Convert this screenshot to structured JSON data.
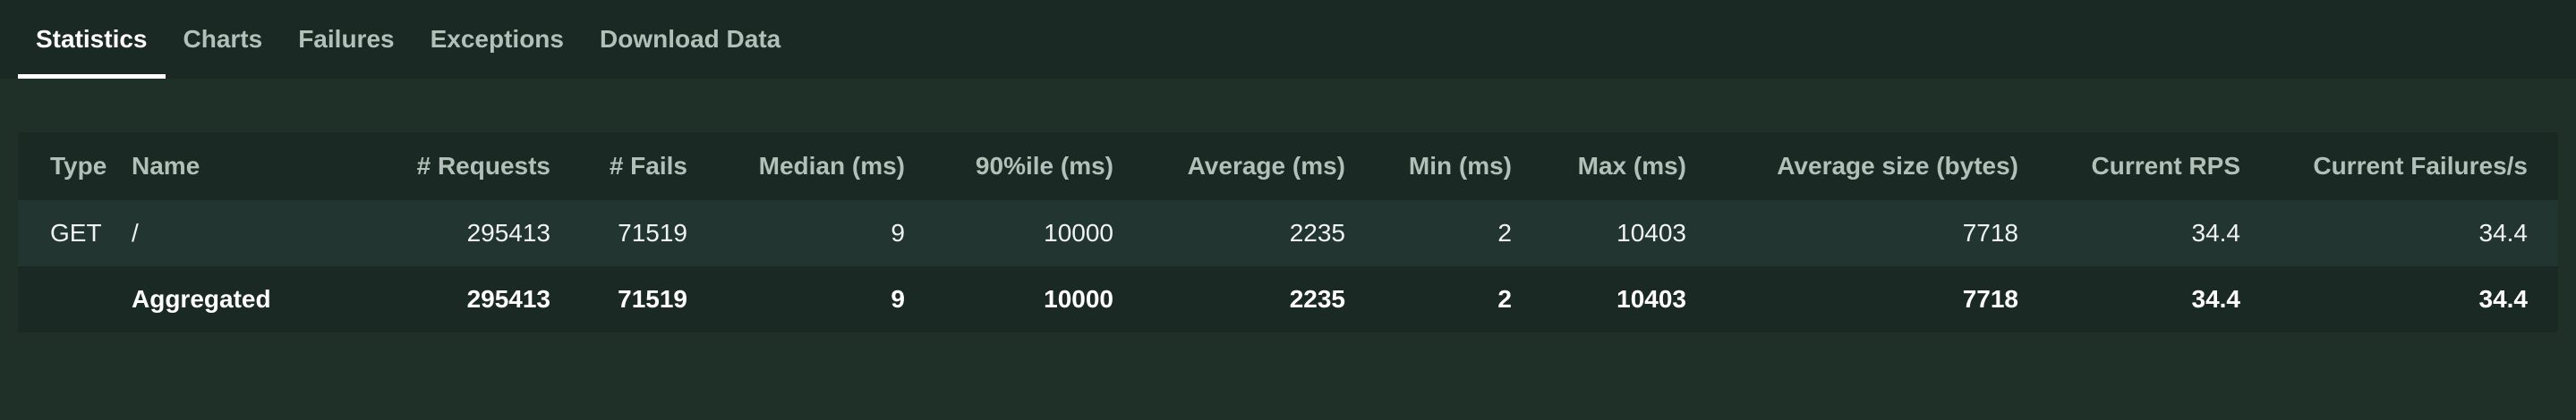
{
  "tabs": [
    {
      "label": "Statistics",
      "active": true
    },
    {
      "label": "Charts"
    },
    {
      "label": "Failures"
    },
    {
      "label": "Exceptions"
    },
    {
      "label": "Download Data"
    }
  ],
  "table": {
    "headers": [
      "Type",
      "Name",
      "# Requests",
      "# Fails",
      "Median (ms)",
      "90%ile (ms)",
      "Average (ms)",
      "Min (ms)",
      "Max (ms)",
      "Average size (bytes)",
      "Current RPS",
      "Current Failures/s"
    ],
    "rows": [
      [
        "GET",
        "/",
        "295413",
        "71519",
        "9",
        "10000",
        "2235",
        "2",
        "10403",
        "7718",
        "34.4",
        "34.4"
      ],
      [
        "",
        "Aggregated",
        "295413",
        "71519",
        "9",
        "10000",
        "2235",
        "2",
        "10403",
        "7718",
        "34.4",
        "34.4"
      ]
    ]
  },
  "colors": {
    "page_background": "#1f3029",
    "header_background": "#1a2923",
    "active_tab_underline": "#ffffff"
  }
}
